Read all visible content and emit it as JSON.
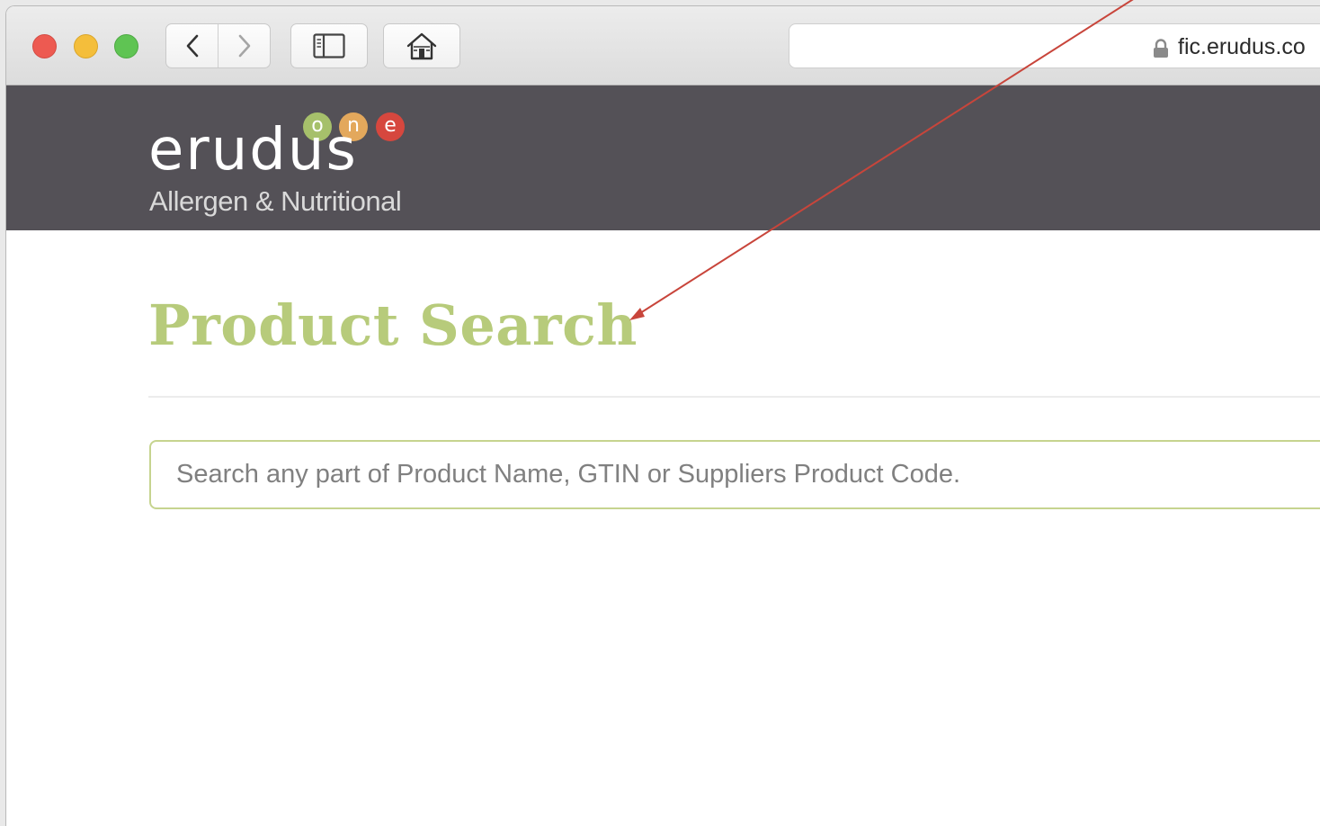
{
  "browser": {
    "address_url": "fic.erudus.co",
    "lock_icon": "lock-icon",
    "back_icon": "chevron-left-icon",
    "forward_icon": "chevron-right-icon",
    "sidebar_icon": "sidebar-icon",
    "home_icon": "home-icon"
  },
  "header": {
    "logo_word": "erudus",
    "logo_dots": [
      "o",
      "n",
      "e"
    ],
    "logo_subtitle": "Allergen & Nutritional",
    "background_color": "#545157"
  },
  "main": {
    "page_title": "Product Search",
    "title_color": "#b7cb7b",
    "search": {
      "placeholder": "Search any part of Product Name, GTIN or Suppliers Product Code.",
      "value": ""
    }
  },
  "annotation": {
    "arrow_color": "#c8453b"
  }
}
